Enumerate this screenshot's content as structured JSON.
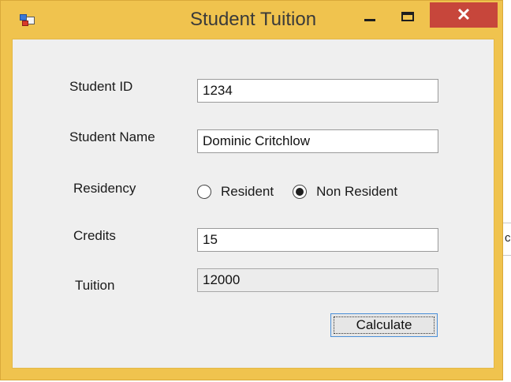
{
  "window": {
    "title": "Student Tuition",
    "controls": {
      "minimize": "minimize",
      "maximize": "maximize",
      "close": "✕"
    }
  },
  "backdrop": {
    "partial_char": "c"
  },
  "form": {
    "student_id": {
      "label": "Student ID",
      "value": "1234"
    },
    "student_name": {
      "label": "Student Name",
      "value": "Dominic Critchlow"
    },
    "residency": {
      "label": "Residency",
      "options": [
        {
          "label": "Resident",
          "selected": false
        },
        {
          "label": "Non Resident",
          "selected": true
        }
      ]
    },
    "credits": {
      "label": "Credits",
      "value": "15"
    },
    "tuition": {
      "label": "Tuition",
      "value": "12000"
    },
    "calculate_label": "Calculate"
  },
  "colors": {
    "frame": "#f0c34e",
    "close": "#c7463b",
    "client": "#efefef",
    "button_border": "#4a8fd8"
  }
}
